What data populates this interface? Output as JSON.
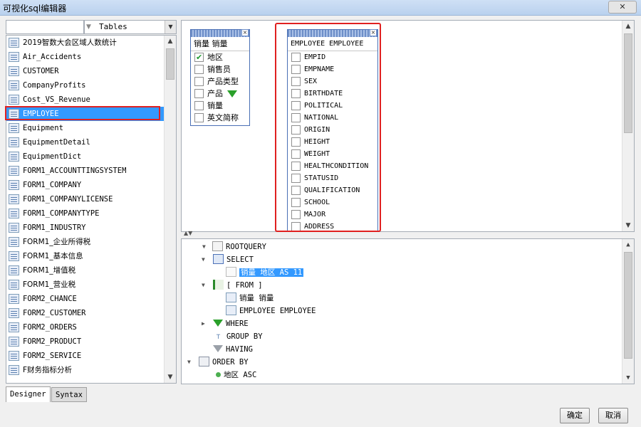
{
  "window": {
    "title": "可视化sql编辑器",
    "close_glyph": "✕"
  },
  "left": {
    "filter_value": "",
    "type_value": "Tables",
    "tables": [
      "2019智数大会区域人数统计",
      "Air_Accidents",
      "CUSTOMER",
      "CompanyProfits",
      "Cost_VS_Revenue",
      "EMPLOYEE",
      "Equipment",
      "EquipmentDetail",
      "EquipmentDict",
      "FORM1_ACCOUNTTINGSYSTEM",
      "FORM1_COMPANY",
      "FORM1_COMPANYLICENSE",
      "FORM1_COMPANYTYPE",
      "FORM1_INDUSTRY",
      "FORM1_企业所得税",
      "FORM1_基本信息",
      "FORM1_增值税",
      "FORM1_营业税",
      "FORM2_CHANCE",
      "FORM2_CUSTOMER",
      "FORM2_ORDERS",
      "FORM2_PRODUCT",
      "FORM2_SERVICE",
      "F财务指标分析"
    ],
    "selected_index": 5,
    "tabs": [
      "Designer",
      "Syntax"
    ]
  },
  "design": {
    "box1": {
      "title": "销量 销量",
      "fields": [
        {
          "label": "地区",
          "checked": true
        },
        {
          "label": "销售员",
          "checked": false
        },
        {
          "label": "产品类型",
          "checked": false
        },
        {
          "label": "产品",
          "checked": false,
          "filter": true
        },
        {
          "label": "销量",
          "checked": false
        },
        {
          "label": "英文简称",
          "checked": false
        }
      ]
    },
    "box2": {
      "title": "EMPLOYEE EMPLOYEE",
      "fields": [
        {
          "label": "EMPID",
          "checked": false
        },
        {
          "label": "EMPNAME",
          "checked": false
        },
        {
          "label": "SEX",
          "checked": false
        },
        {
          "label": "BIRTHDATE",
          "checked": false
        },
        {
          "label": "POLITICAL",
          "checked": false
        },
        {
          "label": "NATIONAL",
          "checked": false
        },
        {
          "label": "ORIGIN",
          "checked": false
        },
        {
          "label": "HEIGHT",
          "checked": false
        },
        {
          "label": "WEIGHT",
          "checked": false
        },
        {
          "label": "HEALTHCONDITION",
          "checked": false
        },
        {
          "label": "STATUSID",
          "checked": false
        },
        {
          "label": "QUALIFICATION",
          "checked": false
        },
        {
          "label": "SCHOOL",
          "checked": false
        },
        {
          "label": "MAJOR",
          "checked": false
        },
        {
          "label": "ADDRESS",
          "checked": false
        }
      ]
    }
  },
  "tree": {
    "root": "ROOTQUERY",
    "select": "SELECT",
    "select_expr": "销量 地区 AS 11",
    "from": "[ FROM ]",
    "from_table1": "销量 销量",
    "from_table2": "EMPLOYEE EMPLOYEE",
    "where": "WHERE",
    "group_by": "GROUP BY",
    "having": "HAVING",
    "order_by": "ORDER BY",
    "order_item": "地区 ASC"
  },
  "buttons": {
    "ok": "确定",
    "cancel": "取消"
  }
}
